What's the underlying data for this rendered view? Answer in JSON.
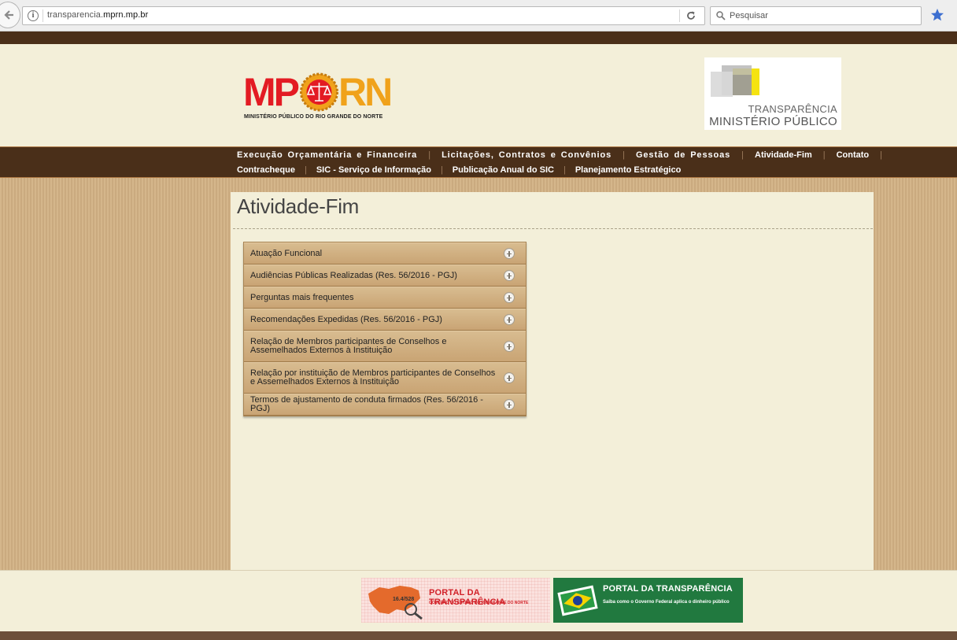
{
  "browser": {
    "url_prefix": "transparencia.",
    "url_domain": "mprn.mp.br",
    "search_placeholder": "Pesquisar"
  },
  "header": {
    "logo_left_part": "MP",
    "logo_right_part": "RN",
    "logo_subtitle": "MINISTÉRIO PÚBLICO DO RIO GRANDE DO NORTE",
    "transparency_line1": "TRANSPARÊNCIA",
    "transparency_line2": "MINISTÉRIO PÚBLICO"
  },
  "nav": {
    "row1": [
      "Execução Orçamentária e Financeira",
      "Licitações, Contratos e Convênios",
      "Gestão de Pessoas",
      "Atividade-Fim",
      "Contato"
    ],
    "row2": [
      "Contracheque",
      "SIC - Serviço de Informação",
      "Publicação Anual do SIC",
      "Planejamento Estratégico"
    ],
    "separator": "|"
  },
  "main": {
    "title": "Atividade-Fim",
    "accordion": [
      "Atuação Funcional",
      "Audiências Públicas Realizadas (Res. 56/2016 - PGJ)",
      "Perguntas mais frequentes",
      "Recomendações Expedidas (Res. 56/2016 - PGJ)",
      "Relação de Membros participantes de Conselhos e Assemelhados Externos à Instituição",
      "Relação por instituição de Membros participantes de Conselhos e Assemelhados Externos à Instituição",
      "Termos de ajustamento de conduta firmados (Res. 56/2016 - PGJ)"
    ]
  },
  "footer": {
    "banner_rn_title": "PORTAL DA TRANSPARÊNCIA",
    "banner_rn_subtitle": "GOVERNO DO ESTADO DO RIO GRANDE DO NORTE",
    "banner_rn_number": "16.4/528",
    "banner_fed_title": "PORTAL DA TRANSPARÊNCIA",
    "banner_fed_subtitle": "Saiba como o Governo Federal aplica o dinheiro público"
  },
  "colors": {
    "nav_brown": "#4a2f19",
    "page_cream": "#f3efd9",
    "side_tan": "#d2b184",
    "logo_red": "#e31b23",
    "logo_orange": "#f0a21b"
  }
}
